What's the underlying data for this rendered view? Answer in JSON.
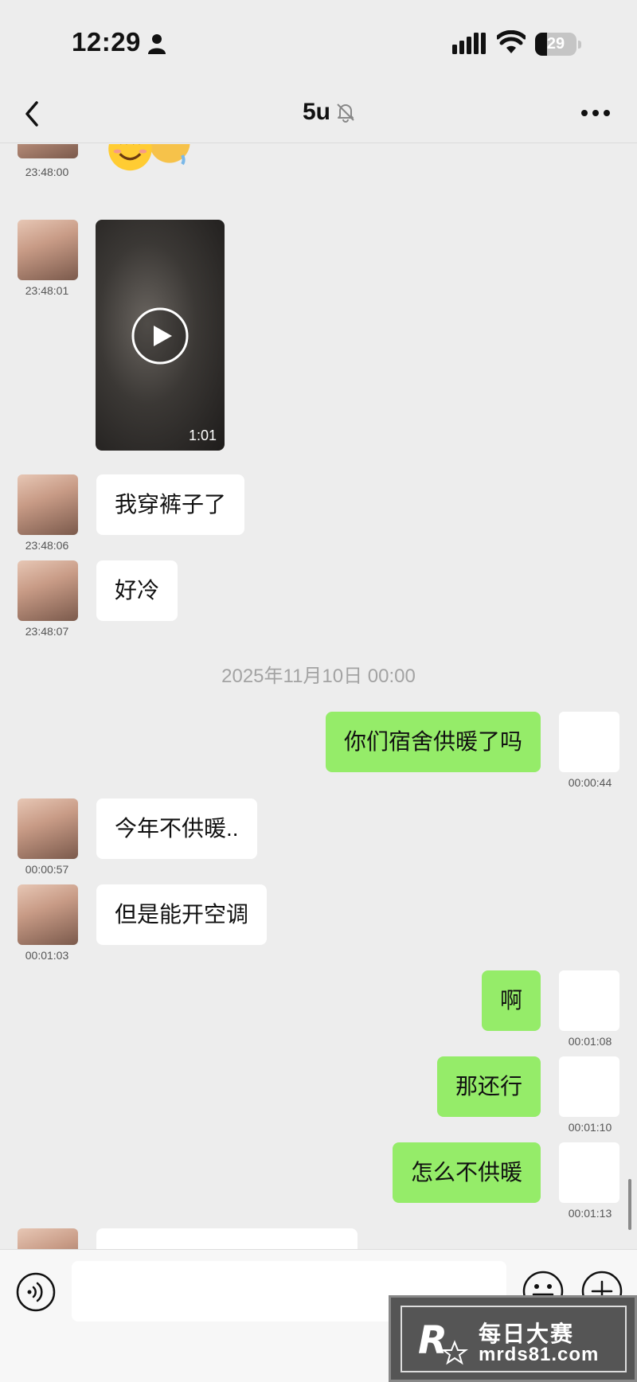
{
  "status_bar": {
    "time": "12:29",
    "battery": "29",
    "battery_level": 0.29
  },
  "chat": {
    "title": "5u"
  },
  "messages": [
    {
      "side": "in",
      "type": "sticker",
      "time": "23:48:00"
    },
    {
      "side": "in",
      "type": "video",
      "duration": "1:01",
      "time": "23:48:01"
    },
    {
      "side": "in",
      "type": "text",
      "text": "我穿裤子了",
      "time": "23:48:06"
    },
    {
      "side": "in",
      "type": "text",
      "text": "好冷",
      "time": "23:48:07"
    },
    {
      "type": "date",
      "text": "2025年11月10日 00:00"
    },
    {
      "side": "out",
      "type": "text",
      "text": "你们宿舍供暖了吗",
      "time": "00:00:44"
    },
    {
      "side": "in",
      "type": "text",
      "text": "今年不供暖..",
      "time": "00:00:57"
    },
    {
      "side": "in",
      "type": "text",
      "text": "但是能开空调",
      "time": "00:01:03"
    },
    {
      "side": "out",
      "type": "text",
      "text": "啊",
      "time": "00:01:08"
    },
    {
      "side": "out",
      "type": "text",
      "text": "那还行",
      "time": "00:01:10"
    },
    {
      "side": "out",
      "type": "text",
      "text": "怎么不供暖",
      "time": "00:01:13"
    }
  ],
  "input": {
    "value": "",
    "placeholder": ""
  },
  "watermark": {
    "title": "每日大赛",
    "url": "mrds81.com"
  },
  "colors": {
    "background": "#ededed",
    "outgoing_bubble": "#95ec69",
    "incoming_bubble": "#ffffff",
    "timestamp": "#555555",
    "date_divider": "#a3a3a3"
  }
}
